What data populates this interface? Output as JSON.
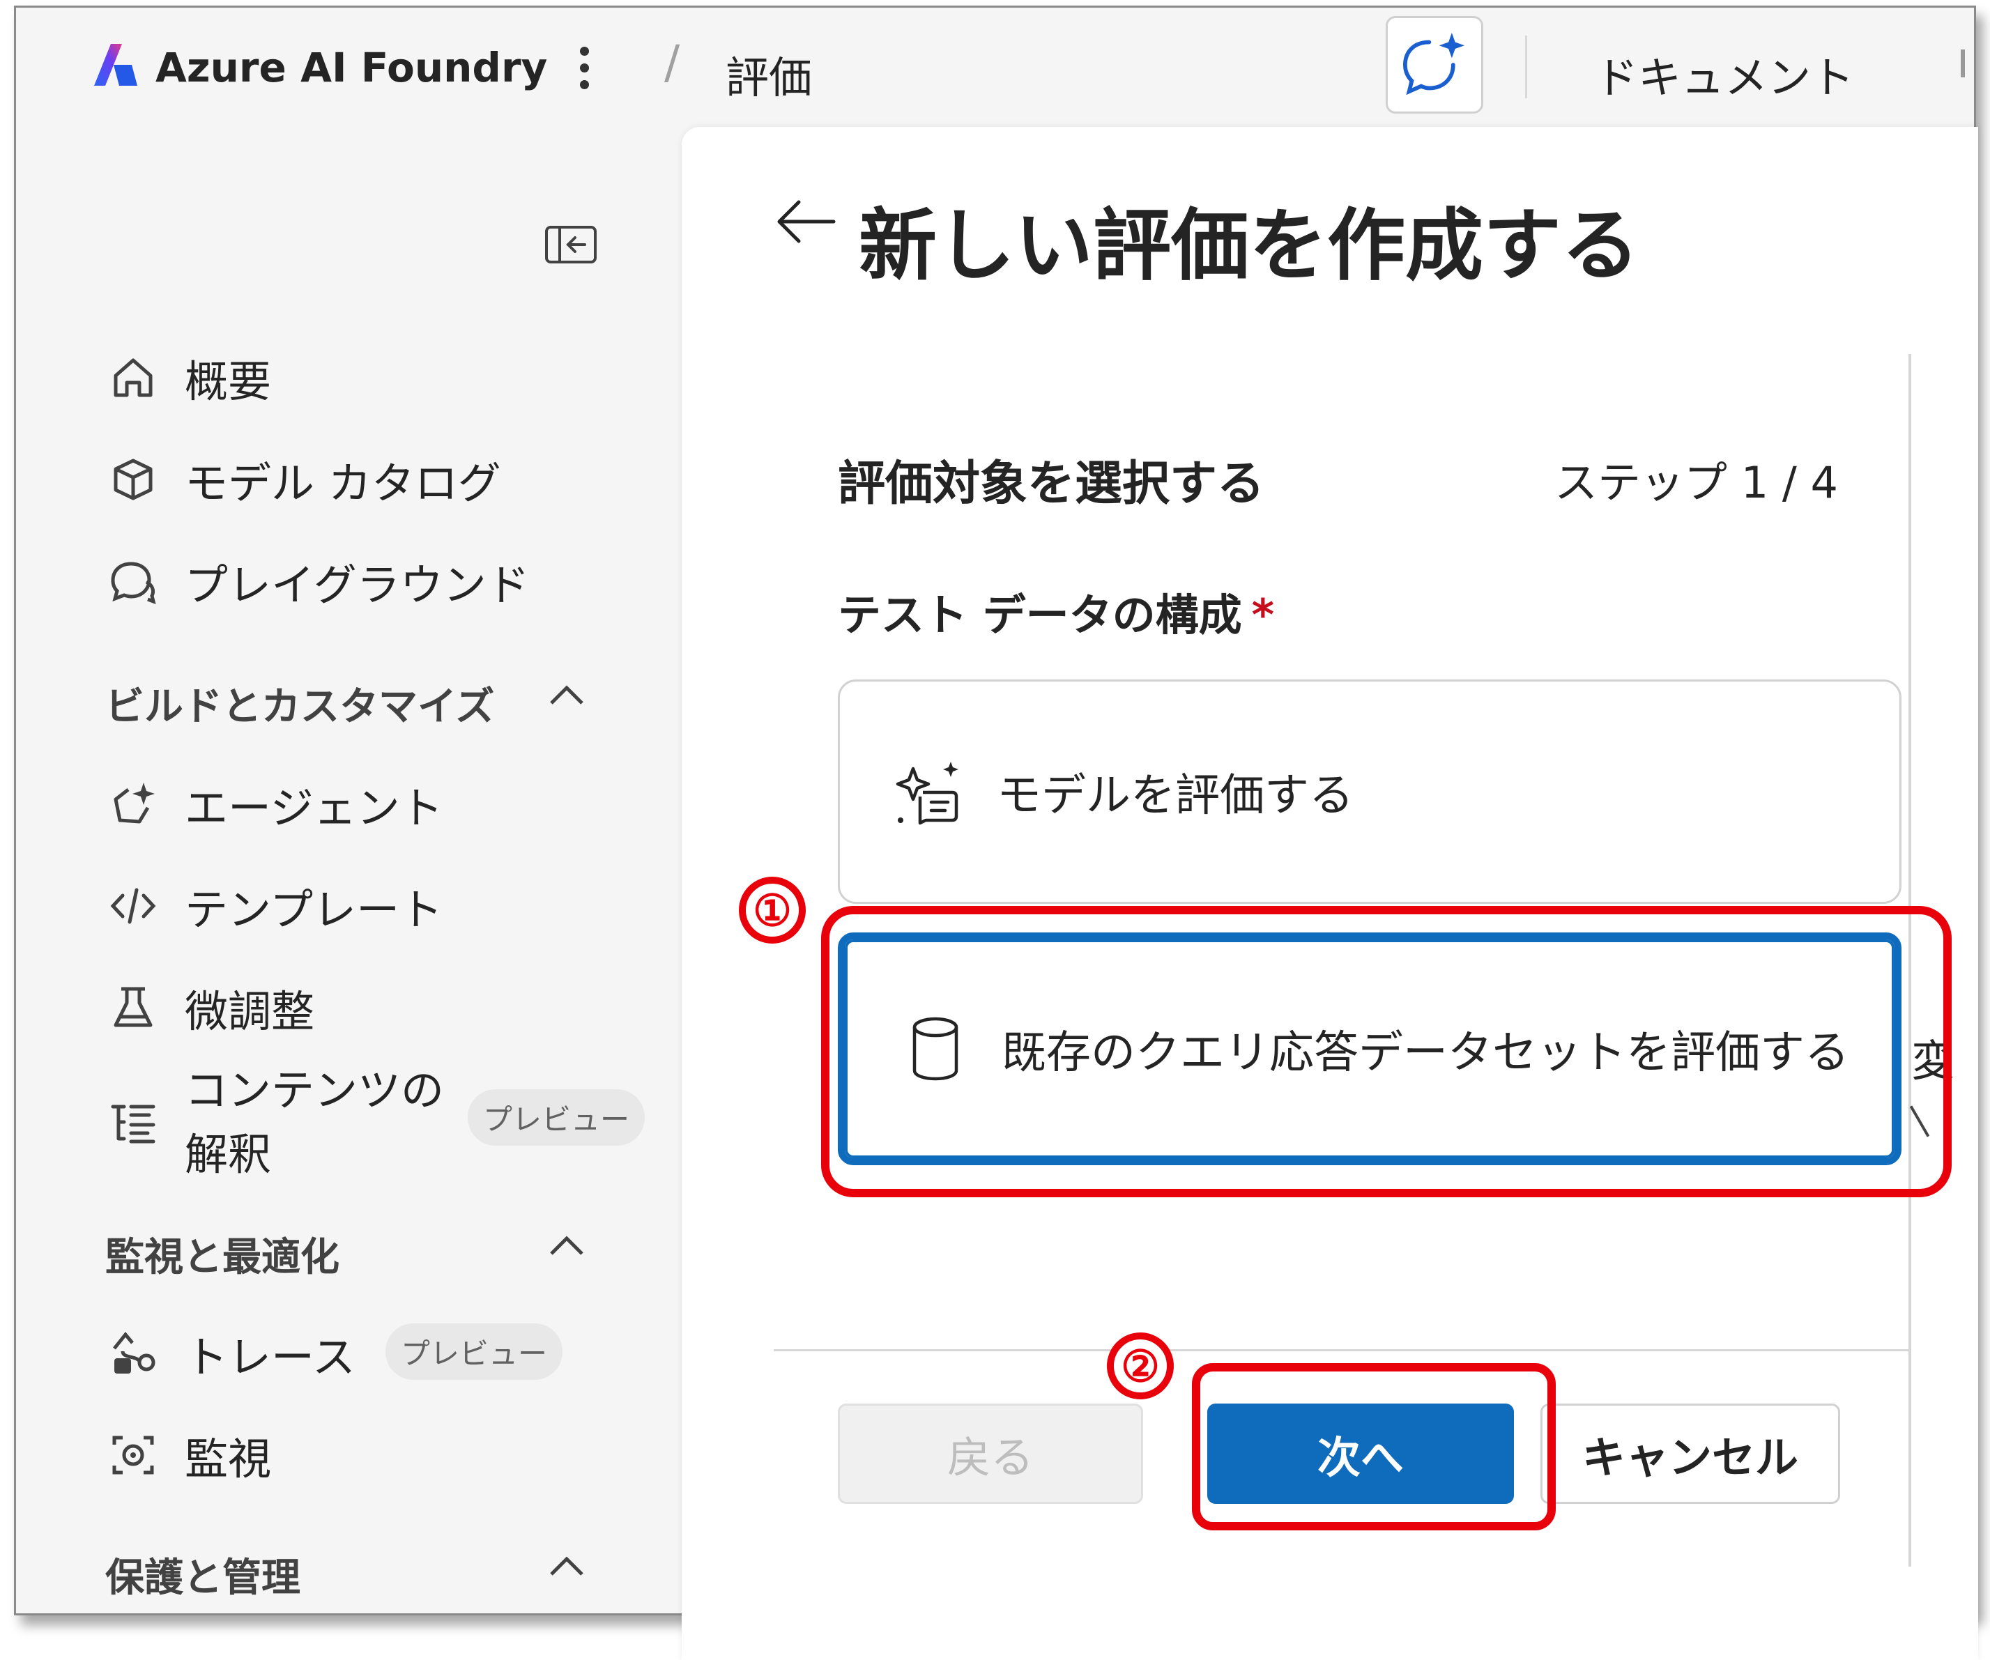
{
  "header": {
    "app_title": "Azure AI Foundry",
    "breadcrumb": "評価",
    "docs_label": "ドキュメント"
  },
  "sidebar": {
    "items": [
      {
        "label": "概要",
        "icon": "home-icon"
      },
      {
        "label": "モデル カタログ",
        "icon": "cube-icon"
      },
      {
        "label": "プレイグラウンド",
        "icon": "chat-icon"
      }
    ],
    "sections": [
      {
        "title": "ビルドとカスタマイズ",
        "items": [
          {
            "label": "エージェント",
            "icon": "agent-sparkle-icon"
          },
          {
            "label": "テンプレート",
            "icon": "code-icon"
          },
          {
            "label": "微調整",
            "icon": "flask-icon"
          },
          {
            "label_line1": "コンテンツの",
            "label_line2": "解釈",
            "icon": "list-tree-icon",
            "badge": "プレビュー"
          }
        ]
      },
      {
        "title": "監視と最適化",
        "items": [
          {
            "label": "トレース",
            "icon": "trace-icon",
            "badge": "プレビュー"
          },
          {
            "label": "監視",
            "icon": "monitor-camera-icon"
          }
        ]
      },
      {
        "title": "保護と管理",
        "items": []
      }
    ]
  },
  "main": {
    "title": "新しい評価を作成する",
    "step_title": "評価対象を選択する",
    "step_counter": "ステップ 1 / 4",
    "field_label": "テスト データの構成",
    "required_mark": "*",
    "options": [
      {
        "label": "モデルを評価する",
        "icon": "sparkle-chat-icon",
        "selected": false
      },
      {
        "label": "既存のクエリ応答データセットを評価する",
        "icon": "database-icon",
        "selected": true
      }
    ],
    "clipped_text": "変",
    "buttons": {
      "back": "戻る",
      "next": "次へ",
      "cancel": "キャンセル"
    }
  },
  "annotations": {
    "marker_1": "①",
    "marker_2": "②",
    "highlight_color": "#e8000b"
  },
  "colors": {
    "accent": "#0f6cbd",
    "background": "#f5f5f5"
  }
}
